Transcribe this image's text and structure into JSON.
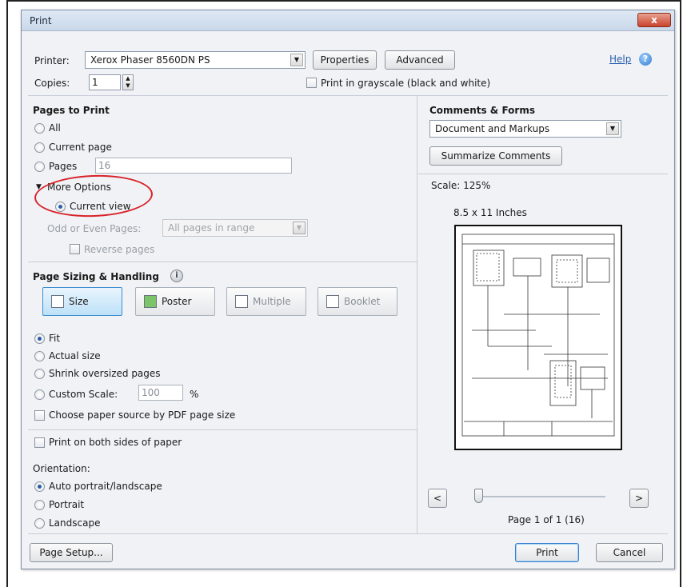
{
  "dialog": {
    "title": "Print",
    "close_label": "x"
  },
  "printer": {
    "label": "Printer:",
    "value": "Xerox Phaser 8560DN PS",
    "properties_label": "Properties",
    "advanced_label": "Advanced",
    "help_label": "Help",
    "help_icon": "?"
  },
  "copies": {
    "label": "Copies:",
    "value": "1"
  },
  "grayscale": {
    "label": "Print in grayscale (black and white)"
  },
  "pages_to_print": {
    "title": "Pages to Print",
    "all_label": "All",
    "current_page_label": "Current page",
    "pages_label": "Pages",
    "pages_value": "16",
    "more_options_label": "More Options",
    "current_view_label": "Current view",
    "odd_even_label": "Odd or Even Pages:",
    "odd_even_value": "All pages in range",
    "reverse_label": "Reverse pages"
  },
  "page_sizing": {
    "title": "Page Sizing & Handling",
    "info_icon": "i",
    "tabs": [
      {
        "label": "Size"
      },
      {
        "label": "Poster"
      },
      {
        "label": "Multiple"
      },
      {
        "label": "Booklet"
      }
    ],
    "fit_label": "Fit",
    "actual_size_label": "Actual size",
    "shrink_label": "Shrink oversized pages",
    "custom_scale_label": "Custom Scale:",
    "custom_scale_value": "100",
    "percent_label": "%",
    "paper_source_label": "Choose paper source by PDF page size"
  },
  "duplex": {
    "label": "Print on both sides of paper"
  },
  "orientation": {
    "title": "Orientation:",
    "auto_label": "Auto portrait/landscape",
    "portrait_label": "Portrait",
    "landscape_label": "Landscape"
  },
  "comments": {
    "title": "Comments & Forms",
    "value": "Document and Markups",
    "summarize_label": "Summarize Comments"
  },
  "preview": {
    "scale_label": "Scale: 125%",
    "paper_size": "8.5 x 11 Inches",
    "prev_label": "<",
    "next_label": ">",
    "page_info": "Page 1 of 1 (16)"
  },
  "footer": {
    "page_setup_label": "Page Setup...",
    "print_label": "Print",
    "cancel_label": "Cancel"
  },
  "colors": {
    "annotation": "#d8232a",
    "selected_tab": "#bde1f8",
    "radio_dot": "#2a5ca8"
  }
}
